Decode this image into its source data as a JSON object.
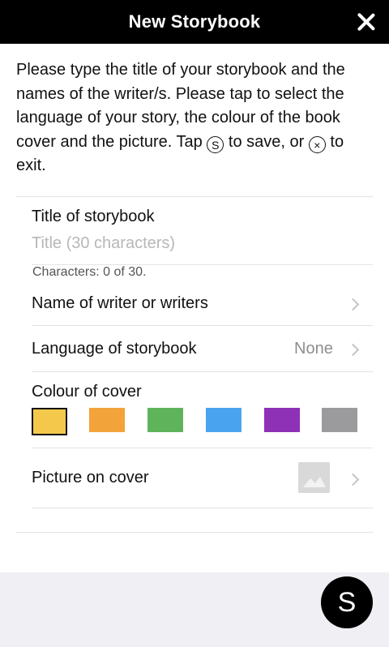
{
  "header": {
    "title": "New Storybook",
    "close_icon": "close-icon"
  },
  "intro": {
    "part1": "Please type the title of your storybook and the names of the writer/s. Please tap to select the language of your story, the colour of the book cover and the picture. Tap ",
    "save_glyph": "S",
    "part2": " to save, or ",
    "exit_glyph": "×",
    "part3": " to exit."
  },
  "form": {
    "title_label": "Title of storybook",
    "title_placeholder": "Title (30 characters)",
    "title_value": "",
    "char_count": "Characters: 0 of 30.",
    "writer_label": "Name of writer or writers",
    "language_label": "Language of storybook",
    "language_value": "None",
    "colour_label": "Colour of cover",
    "colours": [
      "#f4c94b",
      "#f2a33a",
      "#5fb35b",
      "#4aa3ee",
      "#8e31b6",
      "#9b9b9d"
    ],
    "selected_colour": "#f4c94b",
    "picture_label": "Picture on cover",
    "picture_icon": "image-placeholder-icon"
  },
  "fab": {
    "label": "S"
  }
}
